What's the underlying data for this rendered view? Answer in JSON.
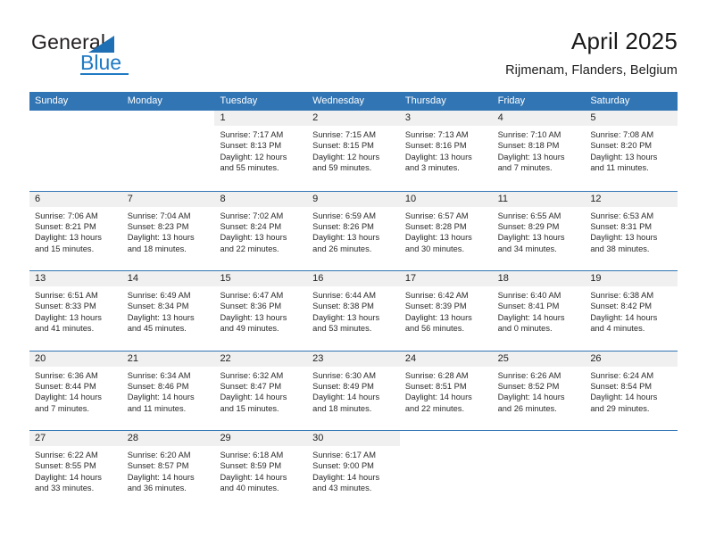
{
  "brand": {
    "name_part1": "General",
    "name_part2": "Blue",
    "triangle_color": "#1f6fb5",
    "blue_color": "#1f7ac4"
  },
  "header": {
    "title": "April 2025",
    "subtitle": "Rijmenam, Flanders, Belgium"
  },
  "theme": {
    "header_blue": "#3175b4",
    "day_strip_gray": "#f0f0f0",
    "text_color": "#2a2a2a"
  },
  "weekdays": [
    "Sunday",
    "Monday",
    "Tuesday",
    "Wednesday",
    "Thursday",
    "Friday",
    "Saturday"
  ],
  "weeks": [
    [
      {
        "day": "",
        "sunrise": "",
        "sunset": "",
        "daylight1": "",
        "daylight2": "",
        "empty": true
      },
      {
        "day": "",
        "sunrise": "",
        "sunset": "",
        "daylight1": "",
        "daylight2": "",
        "empty": true
      },
      {
        "day": "1",
        "sunrise": "Sunrise: 7:17 AM",
        "sunset": "Sunset: 8:13 PM",
        "daylight1": "Daylight: 12 hours",
        "daylight2": "and 55 minutes."
      },
      {
        "day": "2",
        "sunrise": "Sunrise: 7:15 AM",
        "sunset": "Sunset: 8:15 PM",
        "daylight1": "Daylight: 12 hours",
        "daylight2": "and 59 minutes."
      },
      {
        "day": "3",
        "sunrise": "Sunrise: 7:13 AM",
        "sunset": "Sunset: 8:16 PM",
        "daylight1": "Daylight: 13 hours",
        "daylight2": "and 3 minutes."
      },
      {
        "day": "4",
        "sunrise": "Sunrise: 7:10 AM",
        "sunset": "Sunset: 8:18 PM",
        "daylight1": "Daylight: 13 hours",
        "daylight2": "and 7 minutes."
      },
      {
        "day": "5",
        "sunrise": "Sunrise: 7:08 AM",
        "sunset": "Sunset: 8:20 PM",
        "daylight1": "Daylight: 13 hours",
        "daylight2": "and 11 minutes."
      }
    ],
    [
      {
        "day": "6",
        "sunrise": "Sunrise: 7:06 AM",
        "sunset": "Sunset: 8:21 PM",
        "daylight1": "Daylight: 13 hours",
        "daylight2": "and 15 minutes."
      },
      {
        "day": "7",
        "sunrise": "Sunrise: 7:04 AM",
        "sunset": "Sunset: 8:23 PM",
        "daylight1": "Daylight: 13 hours",
        "daylight2": "and 18 minutes."
      },
      {
        "day": "8",
        "sunrise": "Sunrise: 7:02 AM",
        "sunset": "Sunset: 8:24 PM",
        "daylight1": "Daylight: 13 hours",
        "daylight2": "and 22 minutes."
      },
      {
        "day": "9",
        "sunrise": "Sunrise: 6:59 AM",
        "sunset": "Sunset: 8:26 PM",
        "daylight1": "Daylight: 13 hours",
        "daylight2": "and 26 minutes."
      },
      {
        "day": "10",
        "sunrise": "Sunrise: 6:57 AM",
        "sunset": "Sunset: 8:28 PM",
        "daylight1": "Daylight: 13 hours",
        "daylight2": "and 30 minutes."
      },
      {
        "day": "11",
        "sunrise": "Sunrise: 6:55 AM",
        "sunset": "Sunset: 8:29 PM",
        "daylight1": "Daylight: 13 hours",
        "daylight2": "and 34 minutes."
      },
      {
        "day": "12",
        "sunrise": "Sunrise: 6:53 AM",
        "sunset": "Sunset: 8:31 PM",
        "daylight1": "Daylight: 13 hours",
        "daylight2": "and 38 minutes."
      }
    ],
    [
      {
        "day": "13",
        "sunrise": "Sunrise: 6:51 AM",
        "sunset": "Sunset: 8:33 PM",
        "daylight1": "Daylight: 13 hours",
        "daylight2": "and 41 minutes."
      },
      {
        "day": "14",
        "sunrise": "Sunrise: 6:49 AM",
        "sunset": "Sunset: 8:34 PM",
        "daylight1": "Daylight: 13 hours",
        "daylight2": "and 45 minutes."
      },
      {
        "day": "15",
        "sunrise": "Sunrise: 6:47 AM",
        "sunset": "Sunset: 8:36 PM",
        "daylight1": "Daylight: 13 hours",
        "daylight2": "and 49 minutes."
      },
      {
        "day": "16",
        "sunrise": "Sunrise: 6:44 AM",
        "sunset": "Sunset: 8:38 PM",
        "daylight1": "Daylight: 13 hours",
        "daylight2": "and 53 minutes."
      },
      {
        "day": "17",
        "sunrise": "Sunrise: 6:42 AM",
        "sunset": "Sunset: 8:39 PM",
        "daylight1": "Daylight: 13 hours",
        "daylight2": "and 56 minutes."
      },
      {
        "day": "18",
        "sunrise": "Sunrise: 6:40 AM",
        "sunset": "Sunset: 8:41 PM",
        "daylight1": "Daylight: 14 hours",
        "daylight2": "and 0 minutes."
      },
      {
        "day": "19",
        "sunrise": "Sunrise: 6:38 AM",
        "sunset": "Sunset: 8:42 PM",
        "daylight1": "Daylight: 14 hours",
        "daylight2": "and 4 minutes."
      }
    ],
    [
      {
        "day": "20",
        "sunrise": "Sunrise: 6:36 AM",
        "sunset": "Sunset: 8:44 PM",
        "daylight1": "Daylight: 14 hours",
        "daylight2": "and 7 minutes."
      },
      {
        "day": "21",
        "sunrise": "Sunrise: 6:34 AM",
        "sunset": "Sunset: 8:46 PM",
        "daylight1": "Daylight: 14 hours",
        "daylight2": "and 11 minutes."
      },
      {
        "day": "22",
        "sunrise": "Sunrise: 6:32 AM",
        "sunset": "Sunset: 8:47 PM",
        "daylight1": "Daylight: 14 hours",
        "daylight2": "and 15 minutes."
      },
      {
        "day": "23",
        "sunrise": "Sunrise: 6:30 AM",
        "sunset": "Sunset: 8:49 PM",
        "daylight1": "Daylight: 14 hours",
        "daylight2": "and 18 minutes."
      },
      {
        "day": "24",
        "sunrise": "Sunrise: 6:28 AM",
        "sunset": "Sunset: 8:51 PM",
        "daylight1": "Daylight: 14 hours",
        "daylight2": "and 22 minutes."
      },
      {
        "day": "25",
        "sunrise": "Sunrise: 6:26 AM",
        "sunset": "Sunset: 8:52 PM",
        "daylight1": "Daylight: 14 hours",
        "daylight2": "and 26 minutes."
      },
      {
        "day": "26",
        "sunrise": "Sunrise: 6:24 AM",
        "sunset": "Sunset: 8:54 PM",
        "daylight1": "Daylight: 14 hours",
        "daylight2": "and 29 minutes."
      }
    ],
    [
      {
        "day": "27",
        "sunrise": "Sunrise: 6:22 AM",
        "sunset": "Sunset: 8:55 PM",
        "daylight1": "Daylight: 14 hours",
        "daylight2": "and 33 minutes."
      },
      {
        "day": "28",
        "sunrise": "Sunrise: 6:20 AM",
        "sunset": "Sunset: 8:57 PM",
        "daylight1": "Daylight: 14 hours",
        "daylight2": "and 36 minutes."
      },
      {
        "day": "29",
        "sunrise": "Sunrise: 6:18 AM",
        "sunset": "Sunset: 8:59 PM",
        "daylight1": "Daylight: 14 hours",
        "daylight2": "and 40 minutes."
      },
      {
        "day": "30",
        "sunrise": "Sunrise: 6:17 AM",
        "sunset": "Sunset: 9:00 PM",
        "daylight1": "Daylight: 14 hours",
        "daylight2": "and 43 minutes."
      },
      {
        "day": "",
        "sunrise": "",
        "sunset": "",
        "daylight1": "",
        "daylight2": "",
        "empty": true
      },
      {
        "day": "",
        "sunrise": "",
        "sunset": "",
        "daylight1": "",
        "daylight2": "",
        "empty": true
      },
      {
        "day": "",
        "sunrise": "",
        "sunset": "",
        "daylight1": "",
        "daylight2": "",
        "empty": true
      }
    ]
  ]
}
